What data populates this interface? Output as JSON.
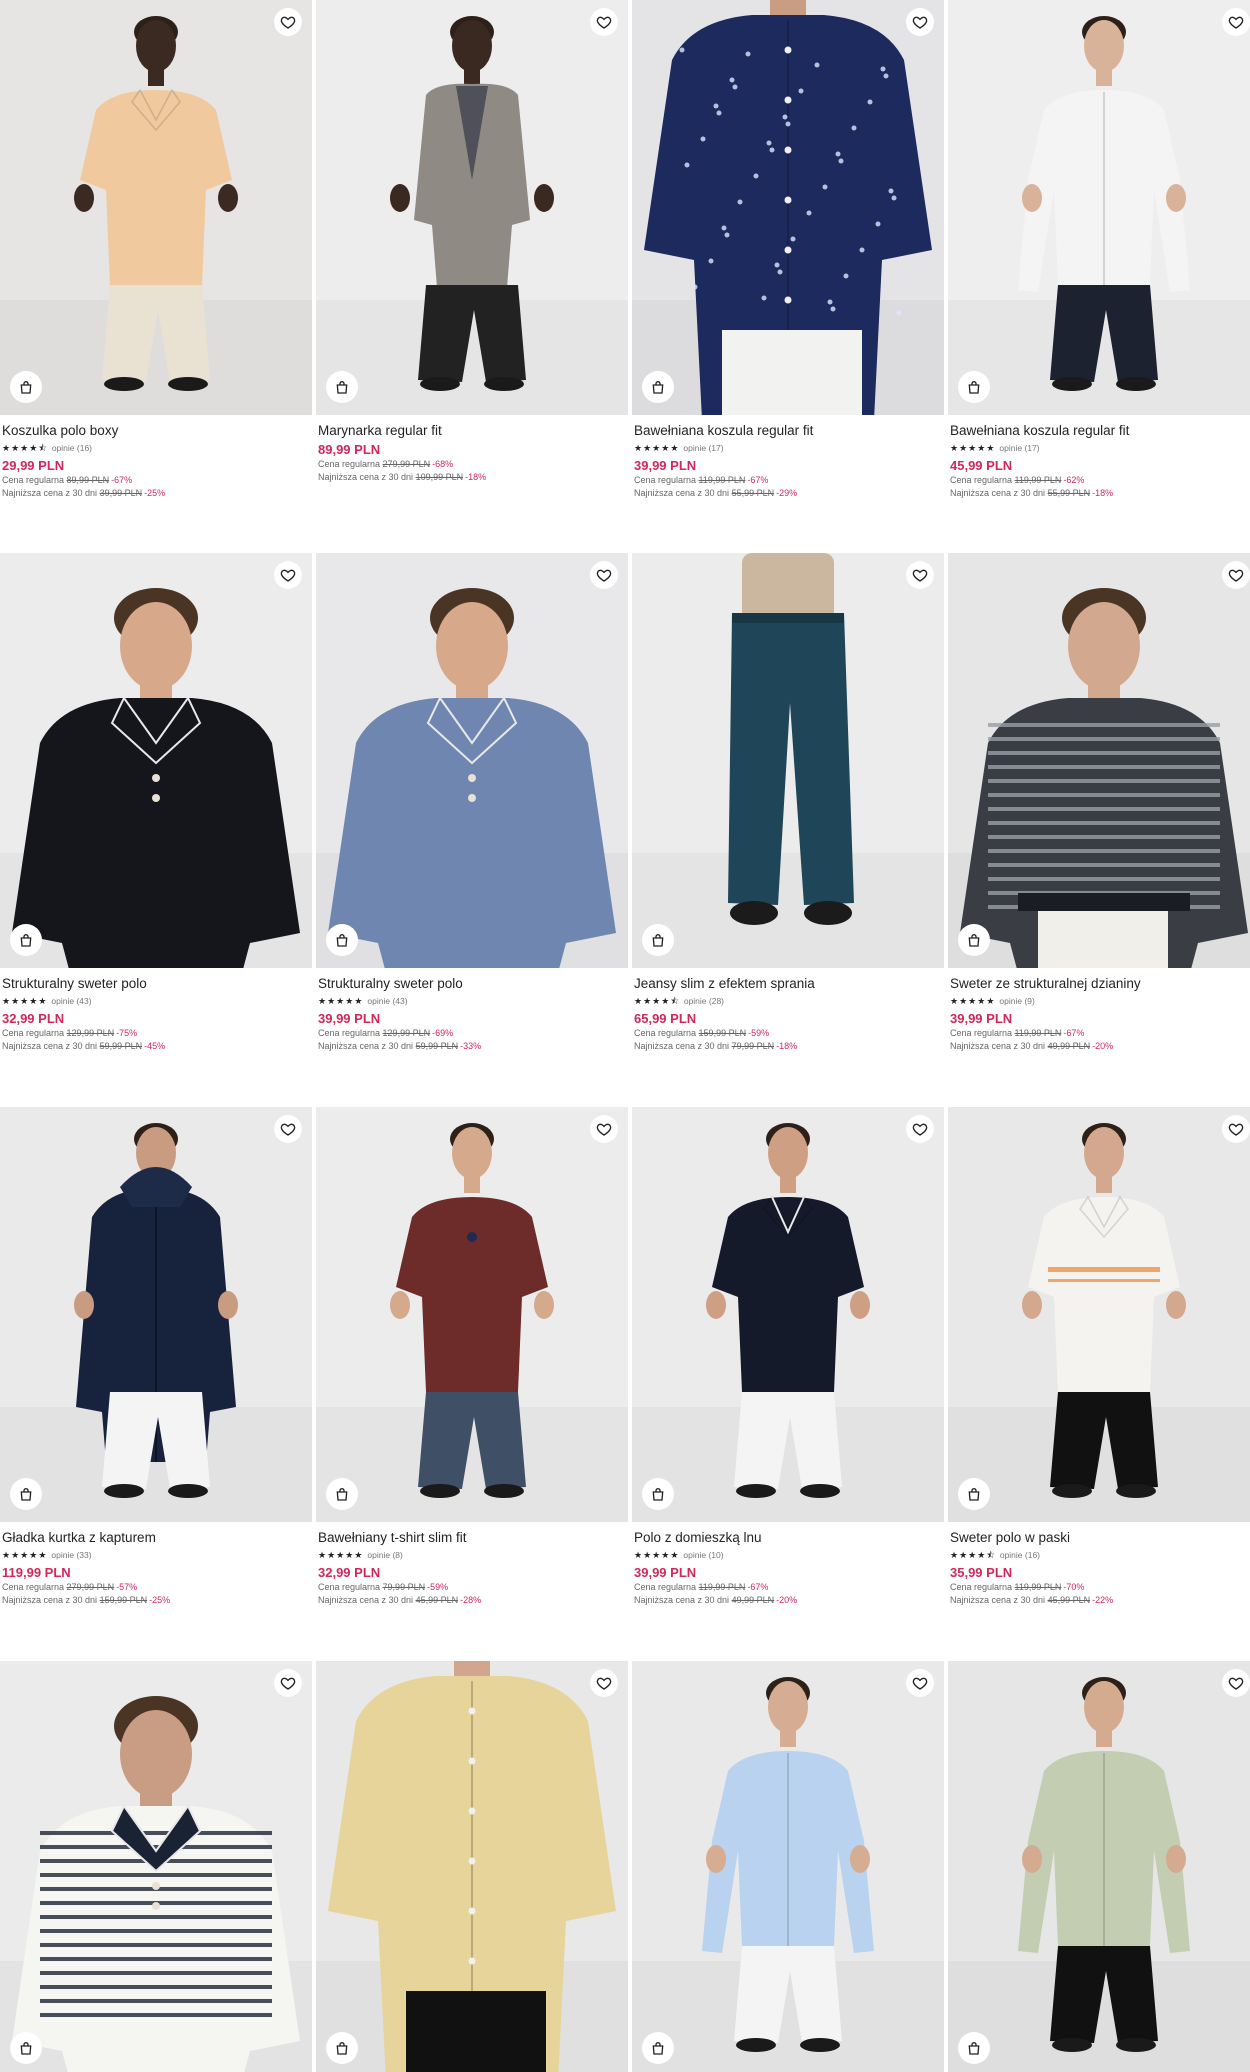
{
  "labels": {
    "regular_prefix": "Cena regularna",
    "lowest_prefix": "Najniższa cena z 30 dni"
  },
  "products": [
    {
      "name": "Koszulka polo boxy",
      "rating": 4.5,
      "reviews": "opinie (16)",
      "price": "29,99 PLN",
      "regular": "89,99 PLN",
      "regular_disc": "-67%",
      "lowest": "39,99 PLN",
      "lowest_disc": "-25%",
      "bg": "#e6e5e3",
      "skin": "#3b2a22",
      "top": "#f0c99e",
      "bottom": "#e9e2d3",
      "style": "polo"
    },
    {
      "name": "Marynarka regular fit",
      "rating": 0,
      "reviews": "",
      "price": "89,99 PLN",
      "regular": "279,99 PLN",
      "regular_disc": "-68%",
      "lowest": "109,99 PLN",
      "lowest_disc": "-18%",
      "bg": "#ededed",
      "skin": "#3a2920",
      "top": "#8f8a84",
      "bottom": "#222222",
      "style": "blazer"
    },
    {
      "name": "Bawełniana koszula regular fit",
      "rating": 5,
      "reviews": "opinie (17)",
      "price": "39,99 PLN",
      "regular": "119,99 PLN",
      "regular_disc": "-67%",
      "lowest": "55,99 PLN",
      "lowest_disc": "-29%",
      "bg": "#e4e4e6",
      "skin": "#c99d84",
      "top": "#1d2a5e",
      "bottom": "#f2f2f0",
      "style": "shirt-crop"
    },
    {
      "name": "Bawełniana koszula regular fit",
      "rating": 5,
      "reviews": "opinie (17)",
      "price": "45,99 PLN",
      "regular": "119,99 PLN",
      "regular_disc": "-62%",
      "lowest": "55,99 PLN",
      "lowest_disc": "-18%",
      "bg": "#eeeeee",
      "skin": "#d9b29a",
      "top": "#f4f4f4",
      "bottom": "#1c2230",
      "style": "shirt"
    },
    {
      "name": "Strukturalny sweter polo",
      "rating": 5,
      "reviews": "opinie (43)",
      "price": "32,99 PLN",
      "regular": "129,99 PLN",
      "regular_disc": "-75%",
      "lowest": "59,99 PLN",
      "lowest_disc": "-45%",
      "bg": "#ececec",
      "skin": "#d7a98a",
      "top": "#14161c",
      "bottom": "#14161c",
      "style": "polo-close"
    },
    {
      "name": "Strukturalny sweter polo",
      "rating": 5,
      "reviews": "opinie (43)",
      "price": "39,99 PLN",
      "regular": "129,99 PLN",
      "regular_disc": "-69%",
      "lowest": "59,99 PLN",
      "lowest_disc": "-33%",
      "bg": "#e8e8ea",
      "skin": "#d7a98a",
      "top": "#6f87b0",
      "bottom": "#6f87b0",
      "style": "polo-close"
    },
    {
      "name": "Jeansy slim z efektem sprania",
      "rating": 4.5,
      "reviews": "opinie (28)",
      "price": "65,99 PLN",
      "regular": "159,99 PLN",
      "regular_disc": "-59%",
      "lowest": "79,99 PLN",
      "lowest_disc": "-18%",
      "bg": "#ececec",
      "skin": "#c9a28a",
      "top": "#cbb7a0",
      "bottom": "#1f4658",
      "style": "jeans"
    },
    {
      "name": "Sweter ze strukturalnej dzianiny",
      "rating": 5,
      "reviews": "opinie (9)",
      "price": "39,99 PLN",
      "regular": "119,99 PLN",
      "regular_disc": "-67%",
      "lowest": "49,99 PLN",
      "lowest_disc": "-20%",
      "bg": "#e6e6e6",
      "skin": "#d2a88f",
      "top": "#3a3d44",
      "bottom": "#f1efe9",
      "style": "sweater"
    },
    {
      "name": "Gładka kurtka z kapturem",
      "rating": 5,
      "reviews": "opinie (33)",
      "price": "119,99 PLN",
      "regular": "279,99 PLN",
      "regular_disc": "-57%",
      "lowest": "159,99 PLN",
      "lowest_disc": "-25%",
      "bg": "#eaeaea",
      "skin": "#c99b80",
      "top": "#17233d",
      "bottom": "#f4f4f4",
      "style": "jacket"
    },
    {
      "name": "Bawełniany t-shirt slim fit",
      "rating": 5,
      "reviews": "opinie (8)",
      "price": "32,99 PLN",
      "regular": "79,99 PLN",
      "regular_disc": "-59%",
      "lowest": "45,99 PLN",
      "lowest_disc": "-28%",
      "bg": "#ececec",
      "skin": "#d5a98c",
      "top": "#6d2c2a",
      "bottom": "#3f4f66",
      "style": "tee"
    },
    {
      "name": "Polo z domieszką lnu",
      "rating": 5,
      "reviews": "opinie (10)",
      "price": "39,99 PLN",
      "regular": "119,99 PLN",
      "regular_disc": "-67%",
      "lowest": "49,99 PLN",
      "lowest_disc": "-20%",
      "bg": "#ebebeb",
      "skin": "#cf9f84",
      "top": "#141a2a",
      "bottom": "#f4f4f4",
      "style": "polo"
    },
    {
      "name": "Sweter polo w paski",
      "rating": 4.5,
      "reviews": "opinie (16)",
      "price": "35,99 PLN",
      "regular": "119,99 PLN",
      "regular_disc": "-70%",
      "lowest": "45,99 PLN",
      "lowest_disc": "-22%",
      "bg": "#e8e8e8",
      "skin": "#d3a88e",
      "top": "#f4f3ef",
      "bottom": "#111111",
      "style": "polo"
    },
    {
      "name": "",
      "rating": 0,
      "reviews": "",
      "price": "",
      "regular": "",
      "regular_disc": "",
      "lowest": "",
      "lowest_disc": "",
      "bg": "#ebebeb",
      "skin": "#c99d84",
      "top": "#f5f5f2",
      "bottom": "#8b7a68",
      "style": "stripe-polo"
    },
    {
      "name": "",
      "rating": 0,
      "reviews": "",
      "price": "",
      "regular": "",
      "regular_disc": "",
      "lowest": "",
      "lowest_disc": "",
      "bg": "#e8e8e8",
      "skin": "#d1a68c",
      "top": "#e6d49a",
      "bottom": "#111111",
      "style": "shirt-crop"
    },
    {
      "name": "",
      "rating": 0,
      "reviews": "",
      "price": "",
      "regular": "",
      "regular_disc": "",
      "lowest": "",
      "lowest_disc": "",
      "bg": "#e9e9e9",
      "skin": "#d6ac92",
      "top": "#b9d2ef",
      "bottom": "#f4f4f4",
      "style": "shirt"
    },
    {
      "name": "",
      "rating": 0,
      "reviews": "",
      "price": "",
      "regular": "",
      "regular_disc": "",
      "lowest": "",
      "lowest_disc": "",
      "bg": "#e6e6e6",
      "skin": "#d5ab90",
      "top": "#c3cdb1",
      "bottom": "#111111",
      "style": "shirt"
    }
  ],
  "icons": {
    "favorite": "heart-icon",
    "cart": "shopping-bag-icon"
  }
}
